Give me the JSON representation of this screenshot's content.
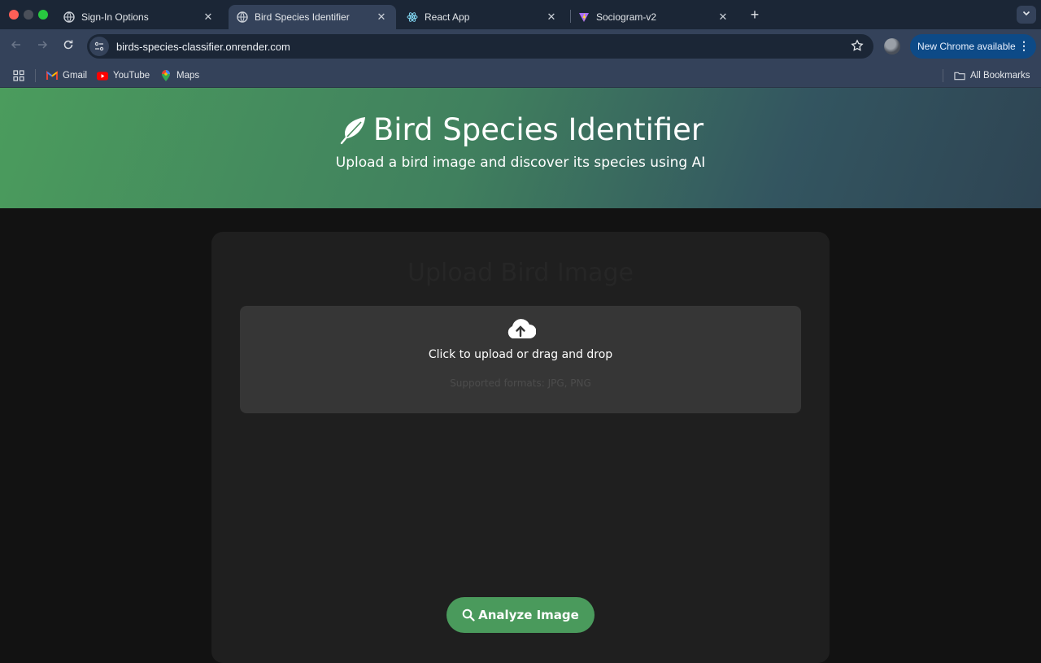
{
  "browser": {
    "tabs": [
      {
        "title": "Sign-In Options",
        "icon": "globe-icon",
        "active": false
      },
      {
        "title": "Bird Species Identifier",
        "icon": "globe-icon",
        "active": true
      },
      {
        "title": "React App",
        "icon": "react-icon",
        "active": false
      },
      {
        "title": "Sociogram-v2",
        "icon": "vite-icon",
        "active": false
      }
    ],
    "close_glyph": "✕",
    "new_tab_glyph": "+",
    "url": "birds-species-classifier.onrender.com",
    "update_label": "New Chrome available",
    "menu_glyph": "⋮",
    "bookmarks": [
      {
        "label": "Gmail",
        "icon": "gmail-icon"
      },
      {
        "label": "YouTube",
        "icon": "youtube-icon"
      },
      {
        "label": "Maps",
        "icon": "maps-icon"
      }
    ],
    "all_bookmarks_label": "All Bookmarks"
  },
  "page": {
    "title": "Bird Species Identifier",
    "subtitle": "Upload a bird image and discover its species using AI",
    "card_title": "Upload Bird Image",
    "dropzone": {
      "main_text": "Click to upload or drag and drop",
      "formats_text": "Supported formats: JPG, PNG"
    },
    "analyze_label": "Analyze Image"
  },
  "colors": {
    "accent_green": "#4a9a5c",
    "chrome_dark": "#1b2636",
    "chrome_mid": "#34425a",
    "update_blue": "#0d4a87"
  }
}
